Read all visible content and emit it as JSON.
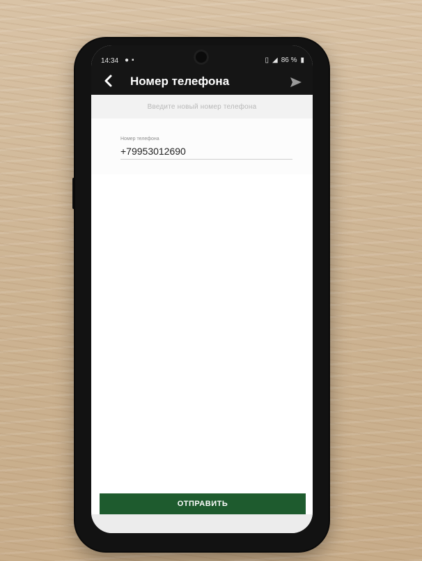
{
  "status_bar": {
    "time": "14:34",
    "right": "86 %"
  },
  "app_bar": {
    "title": "Номер телефона",
    "back_icon": "chevron-left-icon",
    "send_icon": "send-icon"
  },
  "hint": {
    "text": "Введите новый номер телефона"
  },
  "phone_field": {
    "label": "Номер телефона",
    "value": "+79953012690"
  },
  "footer": {
    "submit_label": "ОТПРАВИТЬ"
  },
  "colors": {
    "appbar": "#151515",
    "accent": "#1e5b2e",
    "hint_bg": "#f2f2f2"
  }
}
